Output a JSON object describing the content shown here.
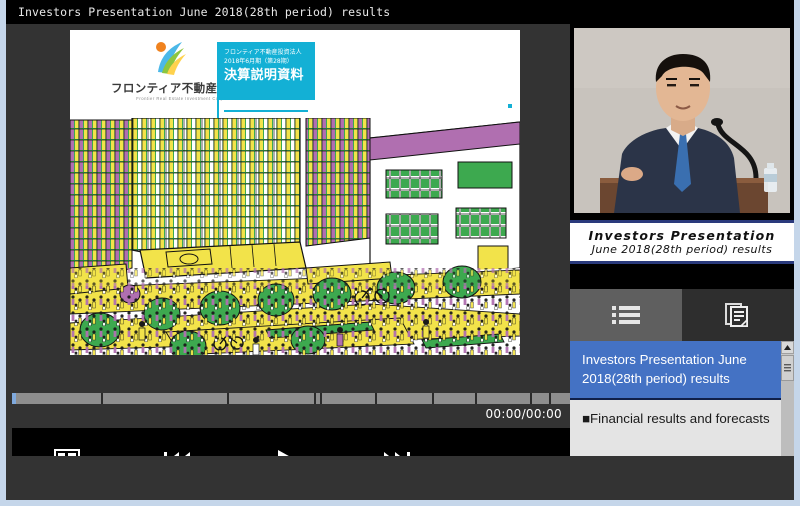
{
  "window": {
    "title": "Investors Presentation June 2018(28th period) results",
    "border_color": "#c5d6ea"
  },
  "slide": {
    "logo": {
      "icon": "frontier-swoosh-logo",
      "company_name_ja": "フロンティア不動産投資法人",
      "company_name_en": "Frontier Real Estate Investment Corporation"
    },
    "title_box": {
      "background": "#13b0d5",
      "line1": "フロンティア不動産投資法人",
      "line2": "2018年6月期（第28期）",
      "line3": "決算説明資料"
    },
    "illustration": {
      "name": "city-street-illustration",
      "palette": [
        "#f5e03c",
        "#3da94f",
        "#b06fb0",
        "#ffffff",
        "#1a1a1a"
      ]
    }
  },
  "player": {
    "time_display": "00:00/00:00",
    "seek": {
      "position_percent": 0,
      "segments": [
        40,
        58,
        40,
        2,
        25,
        26,
        19,
        25,
        8,
        14
      ]
    },
    "controls": [
      {
        "name": "layout-button",
        "icon": "layout-icon",
        "label": "Layout"
      },
      {
        "name": "previous-button",
        "icon": "skip-backward-icon",
        "label": "Previous"
      },
      {
        "name": "play-button",
        "icon": "play-icon",
        "label": "Play"
      },
      {
        "name": "next-button",
        "icon": "skip-forward-icon",
        "label": "Next"
      }
    ]
  },
  "video": {
    "name": "speaker-video",
    "caption_line1": "Investors Presentation",
    "caption_line2": "June 2018(28th period) results",
    "caption_border": "#2a3a7c"
  },
  "panel": {
    "tabs": [
      {
        "name": "tab-index",
        "icon": "bulleted-list-icon",
        "active": true
      },
      {
        "name": "tab-documents",
        "icon": "documents-icon",
        "active": false
      }
    ],
    "list": [
      {
        "label": "Investors Presentation June 2018(28th period) results",
        "selected": true
      },
      {
        "label": "■Financial results and forecasts",
        "selected": false
      }
    ],
    "selected_color": "#4472c4",
    "scrollbar": {
      "up_arrow": "scroll-up-icon",
      "down_arrow": "scroll-down-icon"
    }
  }
}
